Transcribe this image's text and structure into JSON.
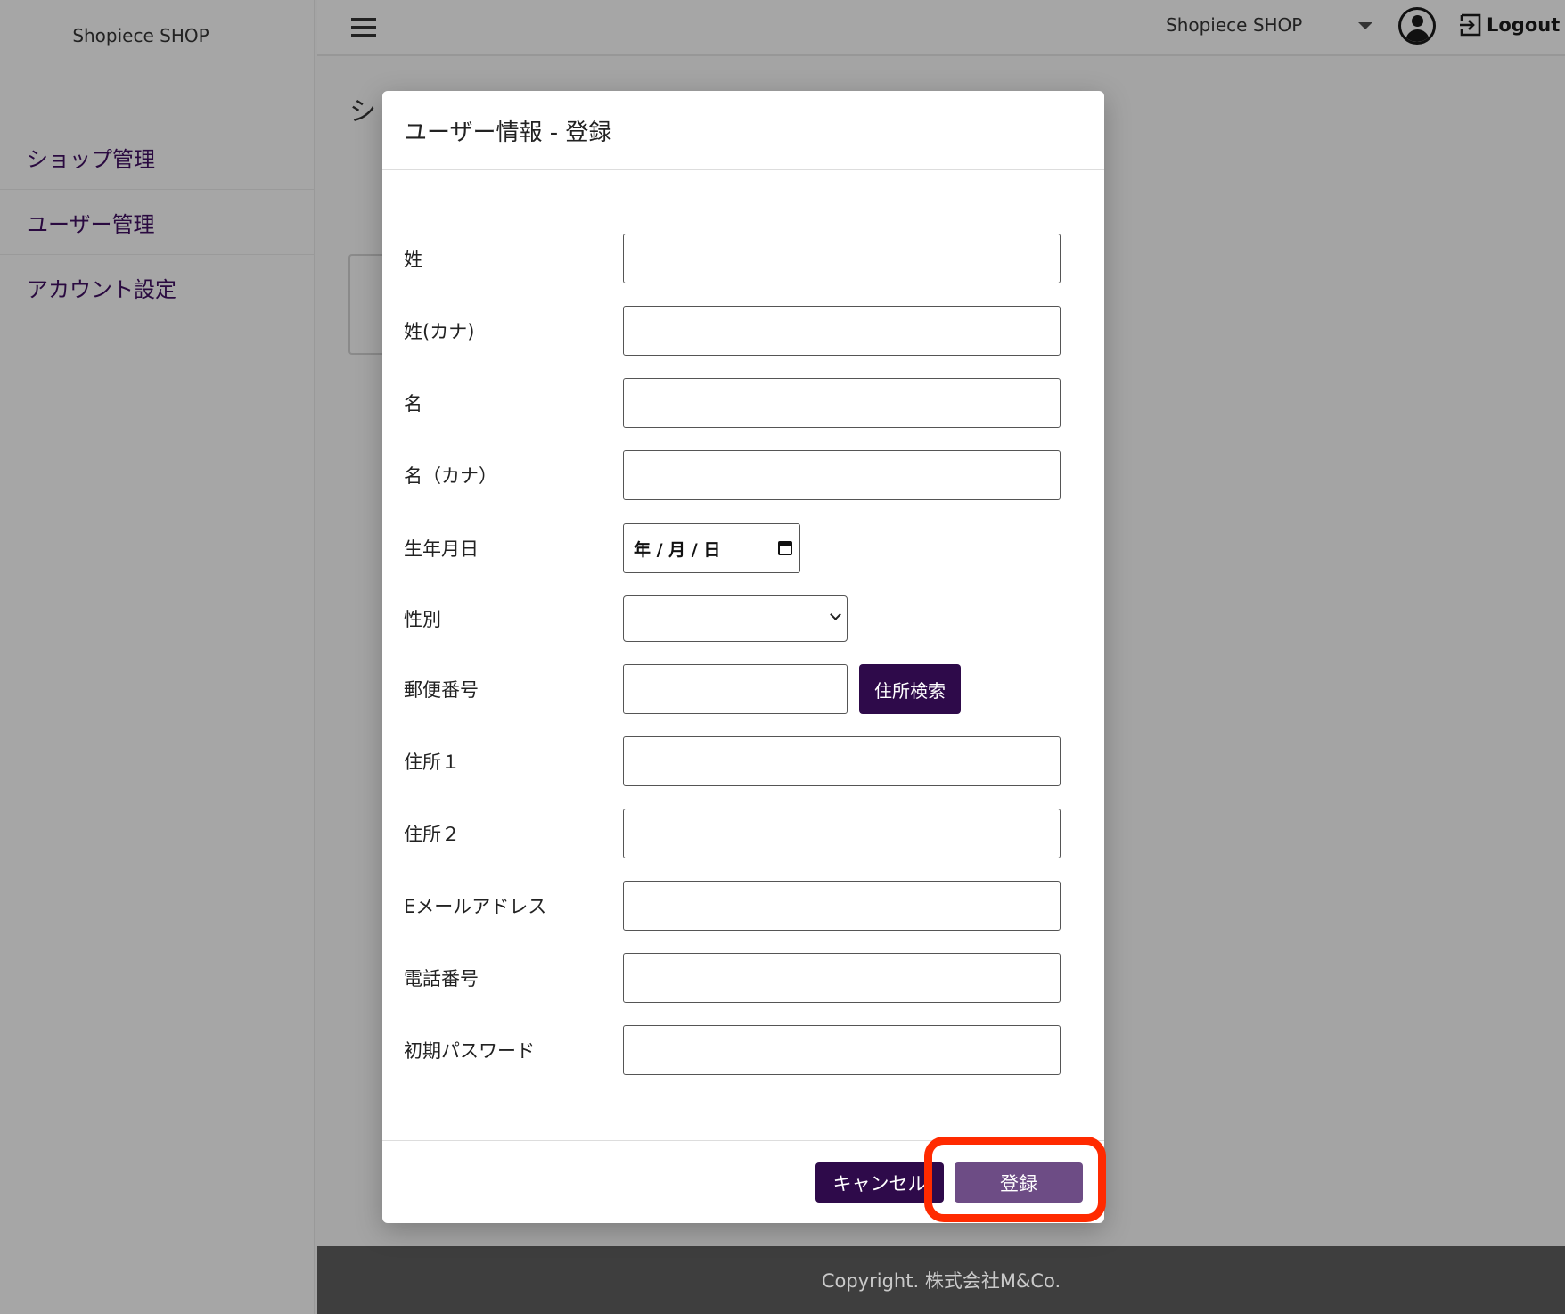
{
  "sidebar": {
    "brand": "Shopiece SHOP",
    "items": [
      {
        "label": "ショップ管理"
      },
      {
        "label": "ユーザー管理"
      },
      {
        "label": "アカウント設定"
      }
    ]
  },
  "header": {
    "shop_name": "Shopiece SHOP",
    "logout_label": "Logout"
  },
  "background": {
    "page_title_fragment": "シ"
  },
  "modal": {
    "title": "ユーザー情報 - 登録",
    "fields": {
      "last_name": {
        "label": "姓",
        "value": ""
      },
      "last_name_kana": {
        "label": "姓(カナ)",
        "value": ""
      },
      "first_name": {
        "label": "名",
        "value": ""
      },
      "first_name_kana": {
        "label": "名（カナ）",
        "value": ""
      },
      "birthday": {
        "label": "生年月日",
        "display": "年 / 月 / 日"
      },
      "gender": {
        "label": "性別",
        "value": ""
      },
      "postal_code": {
        "label": "郵便番号",
        "value": ""
      },
      "address1": {
        "label": "住所１",
        "value": ""
      },
      "address2": {
        "label": "住所２",
        "value": ""
      },
      "email": {
        "label": "Eメールアドレス",
        "value": ""
      },
      "phone": {
        "label": "電話番号",
        "value": ""
      },
      "initial_password": {
        "label": "初期パスワード",
        "value": ""
      }
    },
    "address_search_label": "住所検索",
    "cancel_label": "キャンセル",
    "submit_label": "登録"
  },
  "footer": {
    "copyright": "Copyright. 株式会社M&Co."
  },
  "colors": {
    "primary": "#2e0a4a",
    "submit": "#6d4c85",
    "highlight": "#ff2a00",
    "footer_bg": "#3e3e3e"
  }
}
